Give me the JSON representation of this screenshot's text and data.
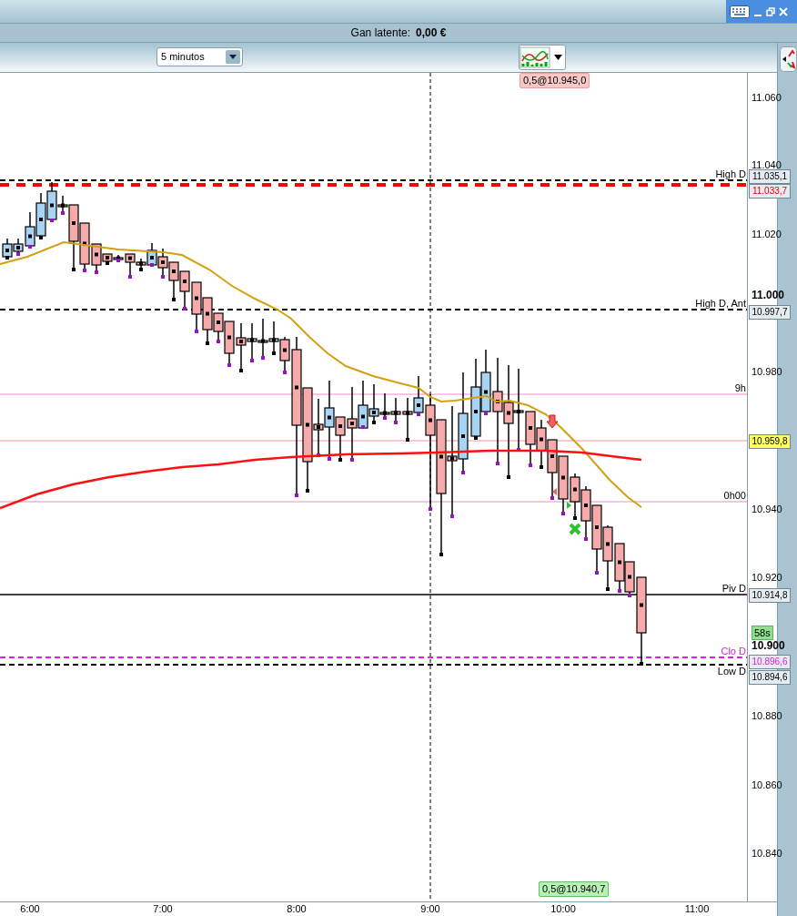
{
  "status_bar": {
    "label": "Gan latente:",
    "value": "0,00 €"
  },
  "toolbar": {
    "timeframe": "5 minutos"
  },
  "chart": {
    "order_tags": [
      {
        "text": "0,5@10.945,0",
        "kind": "sell"
      },
      {
        "text": "0,5@10.940,7",
        "kind": "buy"
      }
    ],
    "level_lines": [
      {
        "label": "High D",
        "kind": "dashed"
      },
      {
        "label": "High D, Ant",
        "kind": "dashed"
      },
      {
        "label": "9h",
        "kind": "pink"
      },
      {
        "label": "0h00",
        "kind": "pink"
      },
      {
        "label": "Piv D",
        "kind": "solid"
      },
      {
        "label": "Clo D",
        "kind": "magenta"
      },
      {
        "label": "Low D",
        "kind": "dashed"
      }
    ],
    "price_ticks": [
      {
        "label": "11.060",
        "bold": false
      },
      {
        "label": "11.040",
        "bold": false
      },
      {
        "label": "11.020",
        "bold": false
      },
      {
        "label": "11.000",
        "bold": true
      },
      {
        "label": "10.980",
        "bold": false
      },
      {
        "label": "10.940",
        "bold": false
      },
      {
        "label": "10.920",
        "bold": false
      },
      {
        "label": "10.900",
        "bold": true
      },
      {
        "label": "10.880",
        "bold": false
      },
      {
        "label": "10.860",
        "bold": false
      },
      {
        "label": "10.840",
        "bold": false
      }
    ],
    "price_tags": [
      {
        "text": "11.035,1",
        "kind": "plain"
      },
      {
        "text": "11.033,7",
        "kind": "red"
      },
      {
        "text": "10.997,7",
        "kind": "plain"
      },
      {
        "text": "10.959,8",
        "kind": "yellow"
      },
      {
        "text": "10.914,8",
        "kind": "plain"
      },
      {
        "text": "10.896,6",
        "kind": "magenta"
      },
      {
        "text": "10.894,6",
        "kind": "plain"
      }
    ],
    "countdown": "58s",
    "time_ticks": [
      "6:00",
      "7:00",
      "8:00",
      "9:00",
      "10:00",
      "11:00"
    ]
  }
}
